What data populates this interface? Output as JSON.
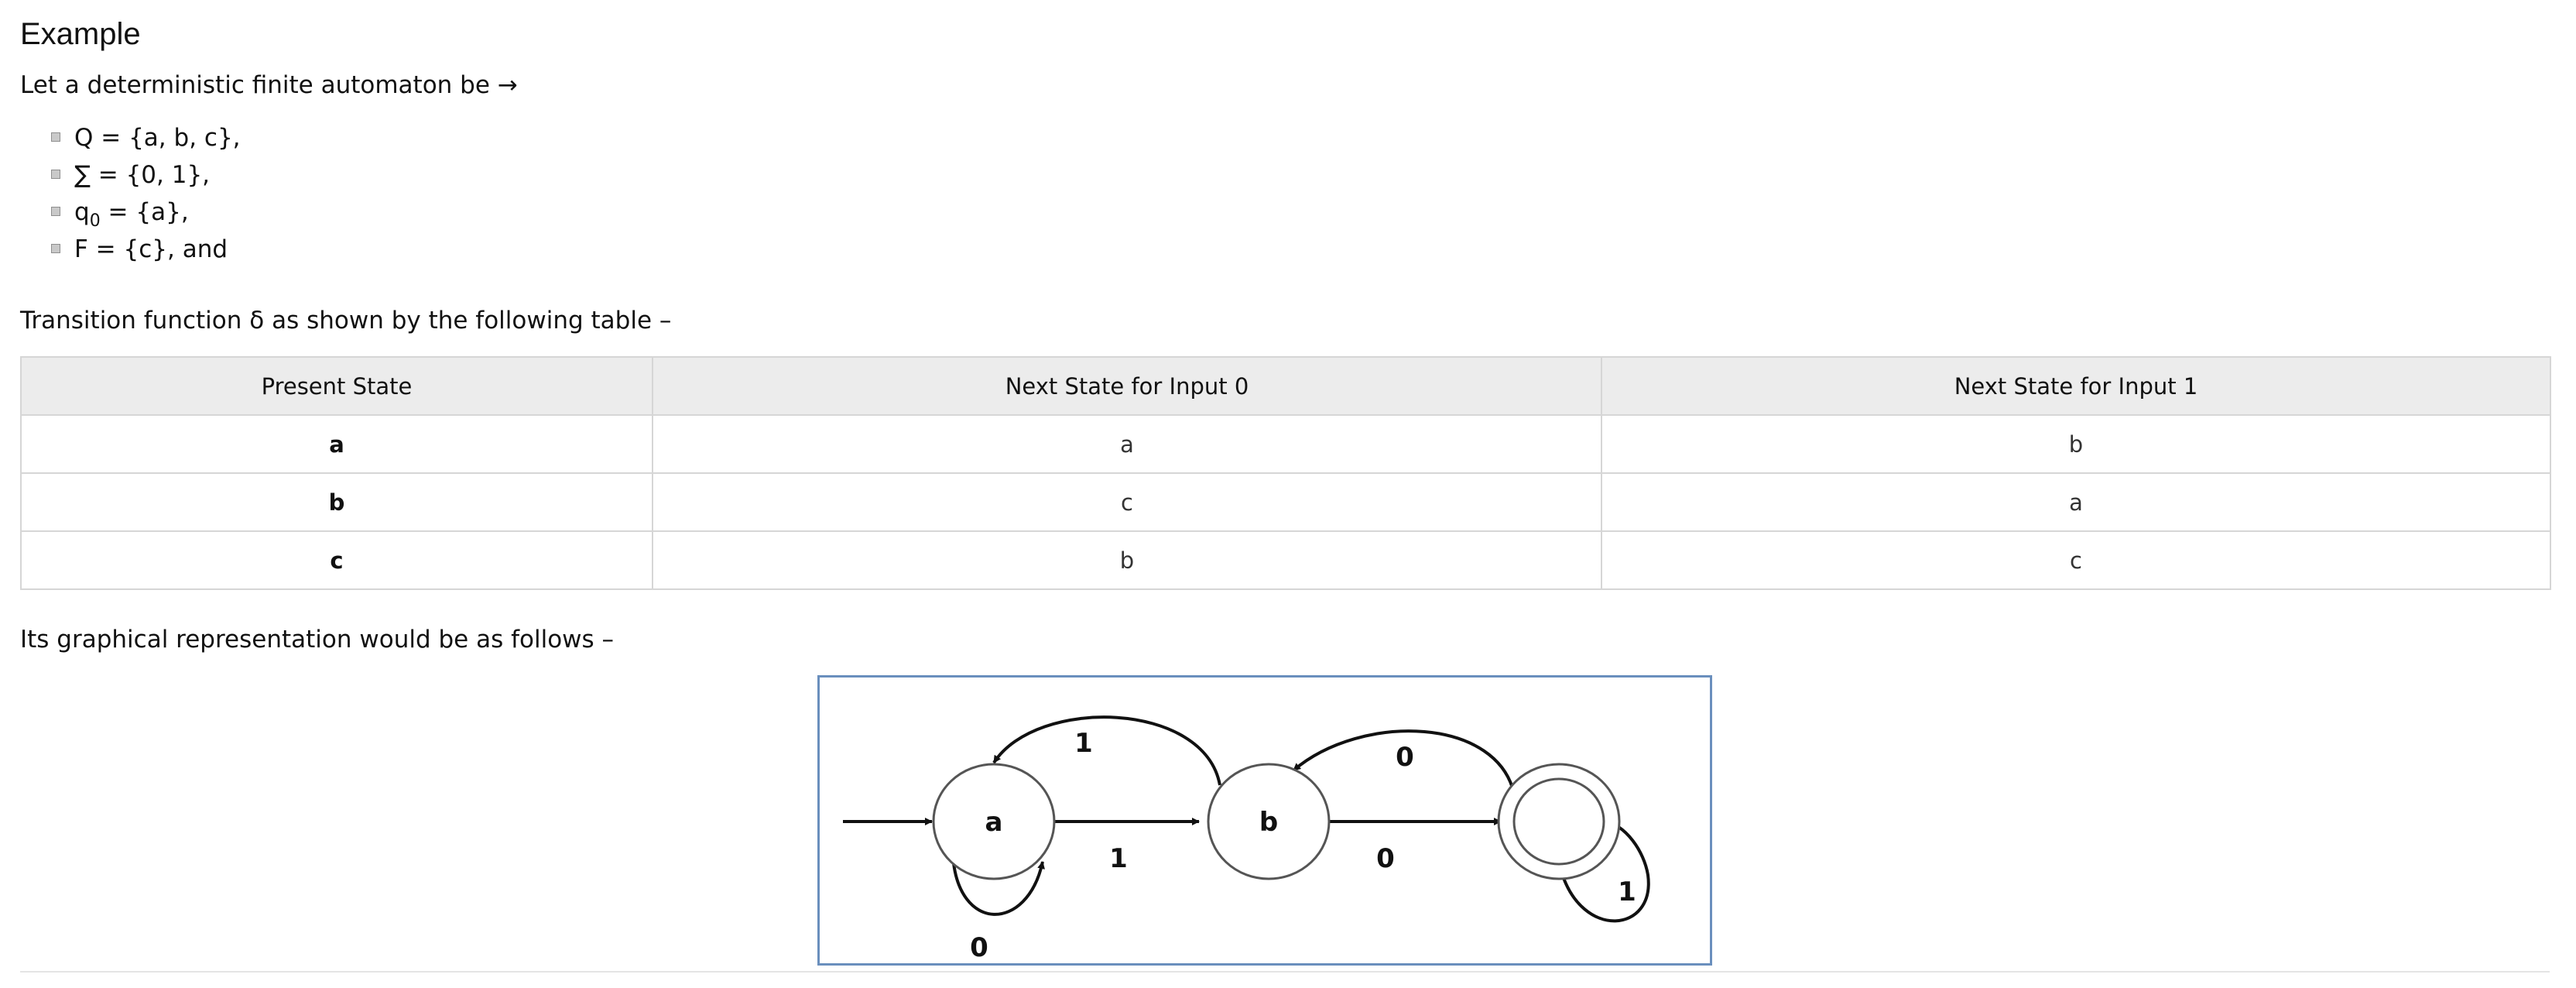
{
  "heading": "Example",
  "intro": "Let a deterministic finite automaton be →",
  "definitions": [
    {
      "pre": "Q = {a, b, c},",
      "sub": "",
      "post": ""
    },
    {
      "pre": "∑ = {0, 1},",
      "sub": "",
      "post": ""
    },
    {
      "pre": "q",
      "sub": "0",
      "post": " = {a},"
    },
    {
      "pre": "F = {c}, and",
      "sub": "",
      "post": ""
    }
  ],
  "transition_intro": "Transition function δ as shown by the following table –",
  "table": {
    "headers": [
      "Present State",
      "Next State for Input 0",
      "Next State for Input 1"
    ],
    "rows": [
      [
        "a",
        "a",
        "b"
      ],
      [
        "b",
        "c",
        "a"
      ],
      [
        "c",
        "b",
        "c"
      ]
    ]
  },
  "graph_intro": "Its graphical representation would be as follows –",
  "diagram": {
    "states": [
      {
        "id": "a",
        "label": "a",
        "accepting": false,
        "start": true
      },
      {
        "id": "b",
        "label": "b",
        "accepting": false,
        "start": false
      },
      {
        "id": "c",
        "label": "",
        "accepting": true,
        "start": false
      }
    ],
    "transitions": [
      {
        "from": "a",
        "to": "a",
        "label": "0"
      },
      {
        "from": "a",
        "to": "b",
        "label": "1"
      },
      {
        "from": "b",
        "to": "a",
        "label": "1"
      },
      {
        "from": "b",
        "to": "c",
        "label": "0"
      },
      {
        "from": "c",
        "to": "b",
        "label": "0"
      },
      {
        "from": "c",
        "to": "c",
        "label": "1"
      }
    ]
  }
}
